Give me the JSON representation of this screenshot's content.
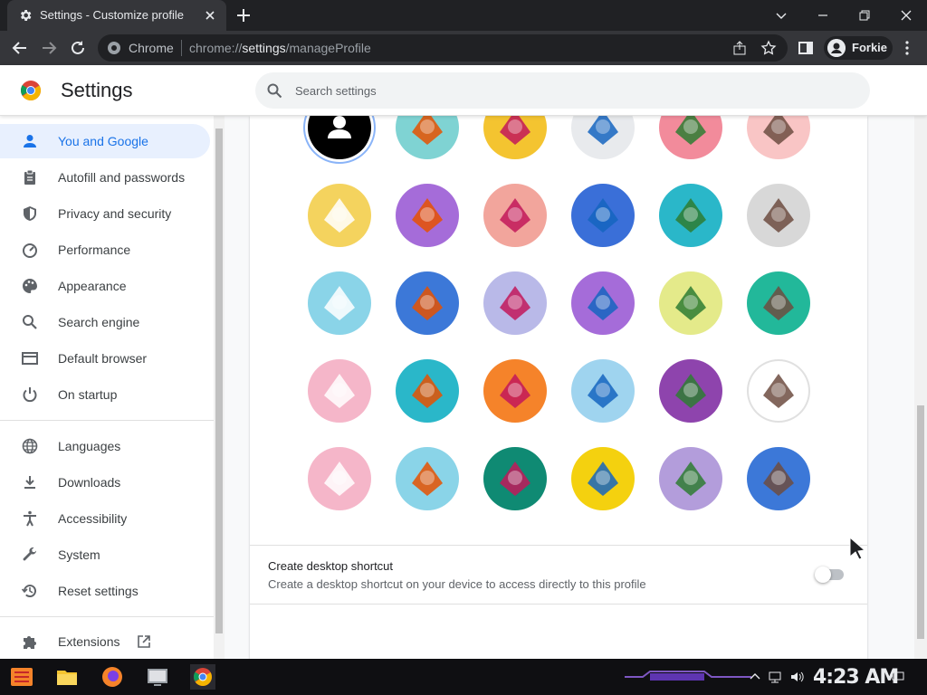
{
  "browser": {
    "tab_title": "Settings - Customize profile",
    "omnibox_chip": "Chrome",
    "url_scheme": "chrome://",
    "url_host": "settings",
    "url_path": "/manageProfile",
    "profile_name": "Forkie"
  },
  "header": {
    "title": "Settings",
    "search_placeholder": "Search settings"
  },
  "sidebar": {
    "items": [
      {
        "label": "You and Google",
        "icon": "person-icon",
        "active": true
      },
      {
        "label": "Autofill and passwords",
        "icon": "clipboard-icon"
      },
      {
        "label": "Privacy and security",
        "icon": "shield-icon"
      },
      {
        "label": "Performance",
        "icon": "speedometer-icon"
      },
      {
        "label": "Appearance",
        "icon": "palette-icon"
      },
      {
        "label": "Search engine",
        "icon": "search-icon"
      },
      {
        "label": "Default browser",
        "icon": "browser-window-icon"
      },
      {
        "label": "On startup",
        "icon": "power-icon"
      },
      {
        "label": "Languages",
        "icon": "globe-icon"
      },
      {
        "label": "Downloads",
        "icon": "download-icon"
      },
      {
        "label": "Accessibility",
        "icon": "accessibility-icon"
      },
      {
        "label": "System",
        "icon": "wrench-icon"
      },
      {
        "label": "Reset settings",
        "icon": "restore-icon"
      },
      {
        "label": "Extensions",
        "icon": "puzzle-icon"
      }
    ]
  },
  "avatars": [
    {
      "name": "generic-person-avatar",
      "bg": "#000000",
      "selected": true
    },
    {
      "name": "origami-cat-avatar",
      "bg": "#7fd3d3"
    },
    {
      "name": "origami-fox-avatar",
      "bg": "#f4c430"
    },
    {
      "name": "origami-dragon-avatar",
      "bg": "#e8eaed"
    },
    {
      "name": "origami-elephant-avatar",
      "bg": "#f28b9b"
    },
    {
      "name": "origami-bird-avatar",
      "bg": "#f9c5c5"
    },
    {
      "name": "origami-monkey-avatar",
      "bg": "#f4d35e"
    },
    {
      "name": "origami-panda-avatar",
      "bg": "#a56cd9"
    },
    {
      "name": "origami-penguin-avatar",
      "bg": "#f2a59c"
    },
    {
      "name": "origami-butterfly-avatar",
      "bg": "#3a6fd8"
    },
    {
      "name": "origami-rabbit-avatar",
      "bg": "#2ab7c9"
    },
    {
      "name": "origami-unicorn-avatar",
      "bg": "#d8d8d8"
    },
    {
      "name": "basketball-avatar",
      "bg": "#8ad4e8"
    },
    {
      "name": "bicycle-avatar",
      "bg": "#3c78d8"
    },
    {
      "name": "red-bird-avatar",
      "bg": "#b9b9e8"
    },
    {
      "name": "cheese-avatar",
      "bg": "#a56cd9"
    },
    {
      "name": "football-avatar",
      "bg": "#e4ea8a"
    },
    {
      "name": "burger-avatar",
      "bg": "#22b89a"
    },
    {
      "name": "sunglasses-avatar",
      "bg": "#f5b6c9"
    },
    {
      "name": "sushi-avatar",
      "bg": "#2ab7c9"
    },
    {
      "name": "virtual-pet-avatar",
      "bg": "#f5832a"
    },
    {
      "name": "vinyl-record-avatar",
      "bg": "#9fd4ef"
    },
    {
      "name": "avocado-avatar",
      "bg": "#8e44ad"
    },
    {
      "name": "smile-avatar",
      "bg": "#ffffff"
    },
    {
      "name": "ice-cream-avatar",
      "bg": "#f5b6c9"
    },
    {
      "name": "ice-cube-avatar",
      "bg": "#8ad4e8"
    },
    {
      "name": "watermelon-avatar",
      "bg": "#0f8a73"
    },
    {
      "name": "onigiri-avatar",
      "bg": "#f4d10f"
    },
    {
      "name": "pizza-avatar",
      "bg": "#b39ddb"
    },
    {
      "name": "sandwich-avatar",
      "bg": "#3c78d8"
    }
  ],
  "shortcut": {
    "title": "Create desktop shortcut",
    "description": "Create a desktop shortcut on your device to access directly to this profile",
    "enabled": false
  },
  "taskbar": {
    "clock": "4:23 AM"
  },
  "colors": {
    "accent": "#1a73e8",
    "active_bg": "#e8f0fe",
    "chrome_dark": "#35363a",
    "tabstrip": "#202124"
  }
}
